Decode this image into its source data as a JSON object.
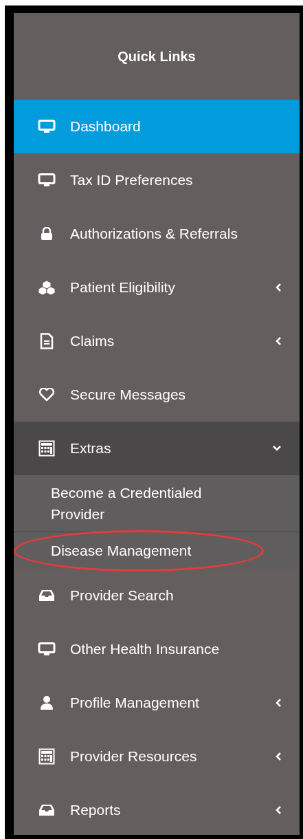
{
  "sidebar": {
    "title": "Quick Links",
    "items": [
      {
        "label": "Dashboard",
        "selected": true
      },
      {
        "label": "Tax ID Preferences",
        "selected": false
      },
      {
        "label": "Authorizations & Referrals",
        "selected": false
      },
      {
        "label": "Patient Eligibility",
        "selected": false,
        "expanded": false
      },
      {
        "label": "Claims",
        "selected": false,
        "expanded": false
      },
      {
        "label": "Secure Messages",
        "selected": false
      },
      {
        "label": "Extras",
        "selected": false,
        "expanded": true,
        "children": [
          {
            "label": "Become a Credentialed Provider",
            "selected": false,
            "circled": false
          },
          {
            "label": "Disease Management",
            "selected": false,
            "circled": true
          }
        ]
      },
      {
        "label": "Provider Search",
        "selected": false
      },
      {
        "label": "Other Health Insurance",
        "selected": false
      },
      {
        "label": "Profile Management",
        "selected": false,
        "expanded": false
      },
      {
        "label": "Provider Resources",
        "selected": false,
        "expanded": false
      },
      {
        "label": "Reports",
        "selected": false,
        "expanded": false
      }
    ]
  }
}
